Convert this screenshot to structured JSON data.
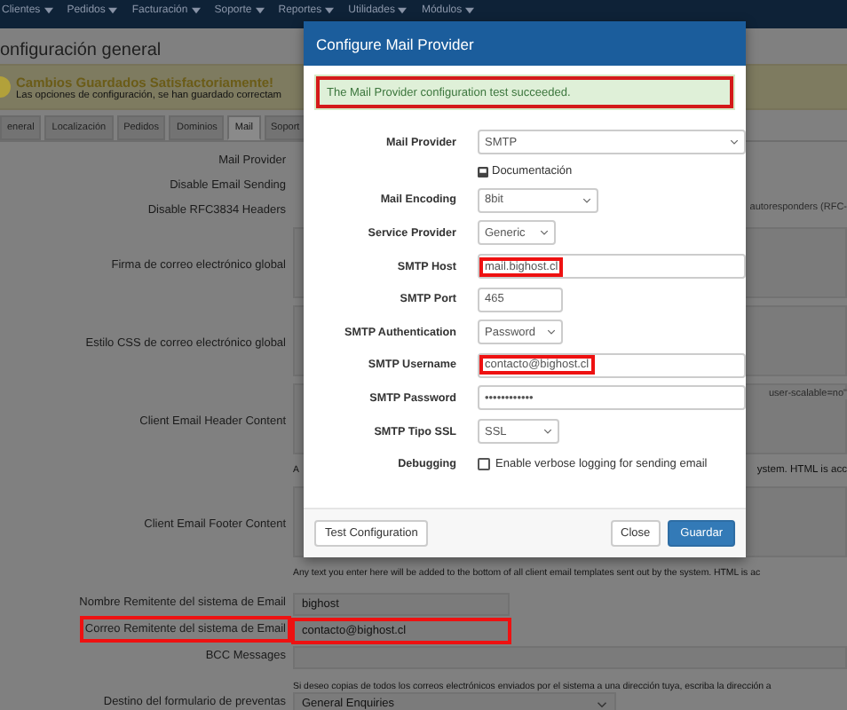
{
  "nav": {
    "items": [
      {
        "label": "Clientes"
      },
      {
        "label": "Pedidos"
      },
      {
        "label": "Facturación"
      },
      {
        "label": "Soporte"
      },
      {
        "label": "Reportes"
      },
      {
        "label": "Utilidades"
      },
      {
        "label": "Módulos"
      }
    ]
  },
  "page_title": "onfiguración general",
  "alert": {
    "title": "Cambios Guardados Satisfactoriamente!",
    "message": "Las opciones de configuración, se han guardado correctam"
  },
  "tabs": [
    {
      "label": "eneral",
      "selected": false
    },
    {
      "label": "Localización",
      "selected": false
    },
    {
      "label": "Pedidos",
      "selected": false
    },
    {
      "label": "Dominios",
      "selected": false
    },
    {
      "label": "Mail",
      "selected": true
    },
    {
      "label": "Soport",
      "selected": false
    }
  ],
  "settings": [
    {
      "kind": "plain",
      "label": "Mail Provider"
    },
    {
      "kind": "plain",
      "label": "Disable Email Sending"
    },
    {
      "kind": "plain",
      "label": "Disable RFC3834 Headers",
      "side_text": "autoresponders (RFC-"
    },
    {
      "kind": "textarea",
      "label": "Firma de correo electrónico global"
    },
    {
      "kind": "textarea",
      "label": "Estilo CSS de correo electrónico global"
    },
    {
      "kind": "textarea",
      "label": "Client Email Header Content",
      "side_text": "user-scalable=no\"",
      "note": "A",
      "note_side": "ystem. HTML is acc"
    },
    {
      "kind": "textarea",
      "label": "Client Email Footer Content",
      "note": "Any text you enter here will be added to the bottom of all client email templates sent out by the system. HTML is ac"
    },
    {
      "kind": "field",
      "label": "Nombre Remitente del sistema de Email",
      "value": "bighost",
      "highlighted": false
    },
    {
      "kind": "field",
      "label": "Correo Remitente del sistema de Email",
      "value": "contacto@bighost.cl",
      "highlighted": true
    },
    {
      "kind": "field",
      "label": "BCC Messages",
      "note": "Si deseo copias de todos los correos electrónicos enviados por el sistema a una dirección tuya, escriba la dirección a"
    },
    {
      "kind": "select",
      "label": "Destino del formulario de preventas",
      "value": "General Enquiries"
    }
  ],
  "modal": {
    "title": "Configure Mail Provider",
    "alert": {
      "text": "The Mail Provider configuration test succeeded.",
      "highlighted": true
    },
    "fields": [
      {
        "kind": "select",
        "label": "Mail Provider",
        "value": "SMTP"
      },
      {
        "kind": "link",
        "text": "Documentación"
      },
      {
        "kind": "select",
        "label": "Mail Encoding",
        "value": "8bit"
      },
      {
        "kind": "select",
        "label": "Service Provider",
        "value": "Generic"
      },
      {
        "kind": "text",
        "label": "SMTP Host",
        "value": "mail.bighost.cl",
        "highlighted": true
      },
      {
        "kind": "text",
        "label": "SMTP Port",
        "value": "465",
        "highlighted": false
      },
      {
        "kind": "select",
        "label": "SMTP Authentication",
        "value": "Password"
      },
      {
        "kind": "text",
        "label": "SMTP Username",
        "value": "contacto@bighost.cl",
        "highlighted": true
      },
      {
        "kind": "text",
        "label": "SMTP Password",
        "value": "••••••••••••",
        "highlighted": false
      },
      {
        "kind": "select",
        "label": "SMTP Tipo SSL",
        "value": "SSL"
      },
      {
        "kind": "checkbox",
        "label": "Debugging",
        "text": "Enable verbose logging for sending email",
        "checked": false
      }
    ],
    "footer": {
      "left_buttons": [
        {
          "label": "Test Configuration",
          "kind": "default"
        }
      ],
      "right_buttons": [
        {
          "label": "Close",
          "kind": "default"
        },
        {
          "label": "Guardar",
          "kind": "primary"
        }
      ]
    }
  }
}
